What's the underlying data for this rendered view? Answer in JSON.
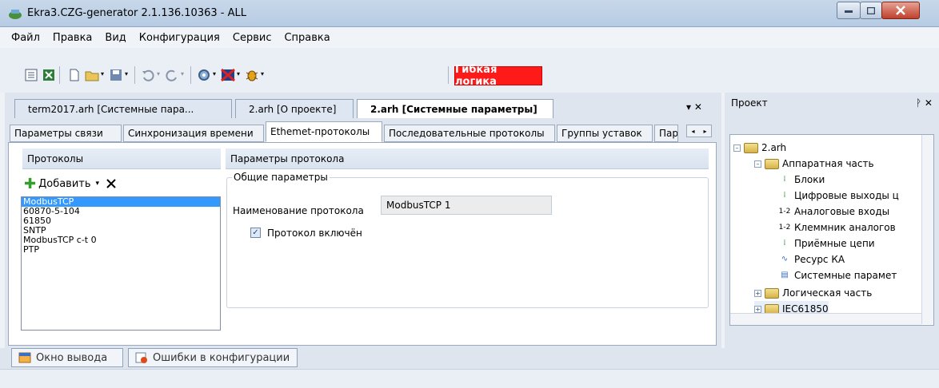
{
  "window": {
    "title": "Ekra3.CZG-generator 2.1.136.10363 - ALL"
  },
  "menu": [
    "Файл",
    "Правка",
    "Вид",
    "Конфигурация",
    "Сервис",
    "Справка"
  ],
  "toolbar": {
    "flex_logic_label": "Гибкая логика"
  },
  "doc_tabs": [
    {
      "label": "term2017.arh [Системные пара..."
    },
    {
      "label": "2.arh [О проекте]"
    },
    {
      "label": "2.arh [Системные параметры]"
    }
  ],
  "doc_menu": {
    "label": "▾ ✕"
  },
  "inner_tabs": [
    {
      "label": "Параметры связи"
    },
    {
      "label": "Синхронизация времени"
    },
    {
      "label": "Ethemet-протоколы"
    },
    {
      "label": "Последовательные протоколы"
    },
    {
      "label": "Группы уставок"
    },
    {
      "label": "Пар"
    }
  ],
  "protocols_panel": {
    "title": "Протоколы",
    "add_label": "Добавить",
    "items": [
      "ModbusTCP",
      "60870-5-104",
      "61850",
      "SNTP",
      "ModbusTCP c-t 0",
      "PTP"
    ],
    "selected": "ModbusTCP"
  },
  "params_panel": {
    "title": "Параметры протокола",
    "group_title": "Общие параметры",
    "name_label": "Наименование протокола",
    "name_value": "ModbusTCP 1",
    "enabled_label": "Протокол включён",
    "enabled": true
  },
  "project_panel": {
    "title": "Проект",
    "pin_label": "ᚹ ✕",
    "tree": {
      "root": "2.arh",
      "hardware": "Аппаратная часть",
      "hardware_items": [
        "Блоки",
        "Цифровые выходы ц",
        "Аналоговые входы",
        "Клеммник аналогов",
        "Приёмные цепи",
        "Ресурс КА",
        "Системные парамет"
      ],
      "logic": "Логическая часть",
      "iec": "IEC61850"
    }
  },
  "bottom_tabs": [
    {
      "label": "Окно вывода"
    },
    {
      "label": "Ошибки в конфигурации"
    }
  ],
  "colors": {
    "accent_red": "#ff1a1a",
    "selection": "#3399ff"
  }
}
